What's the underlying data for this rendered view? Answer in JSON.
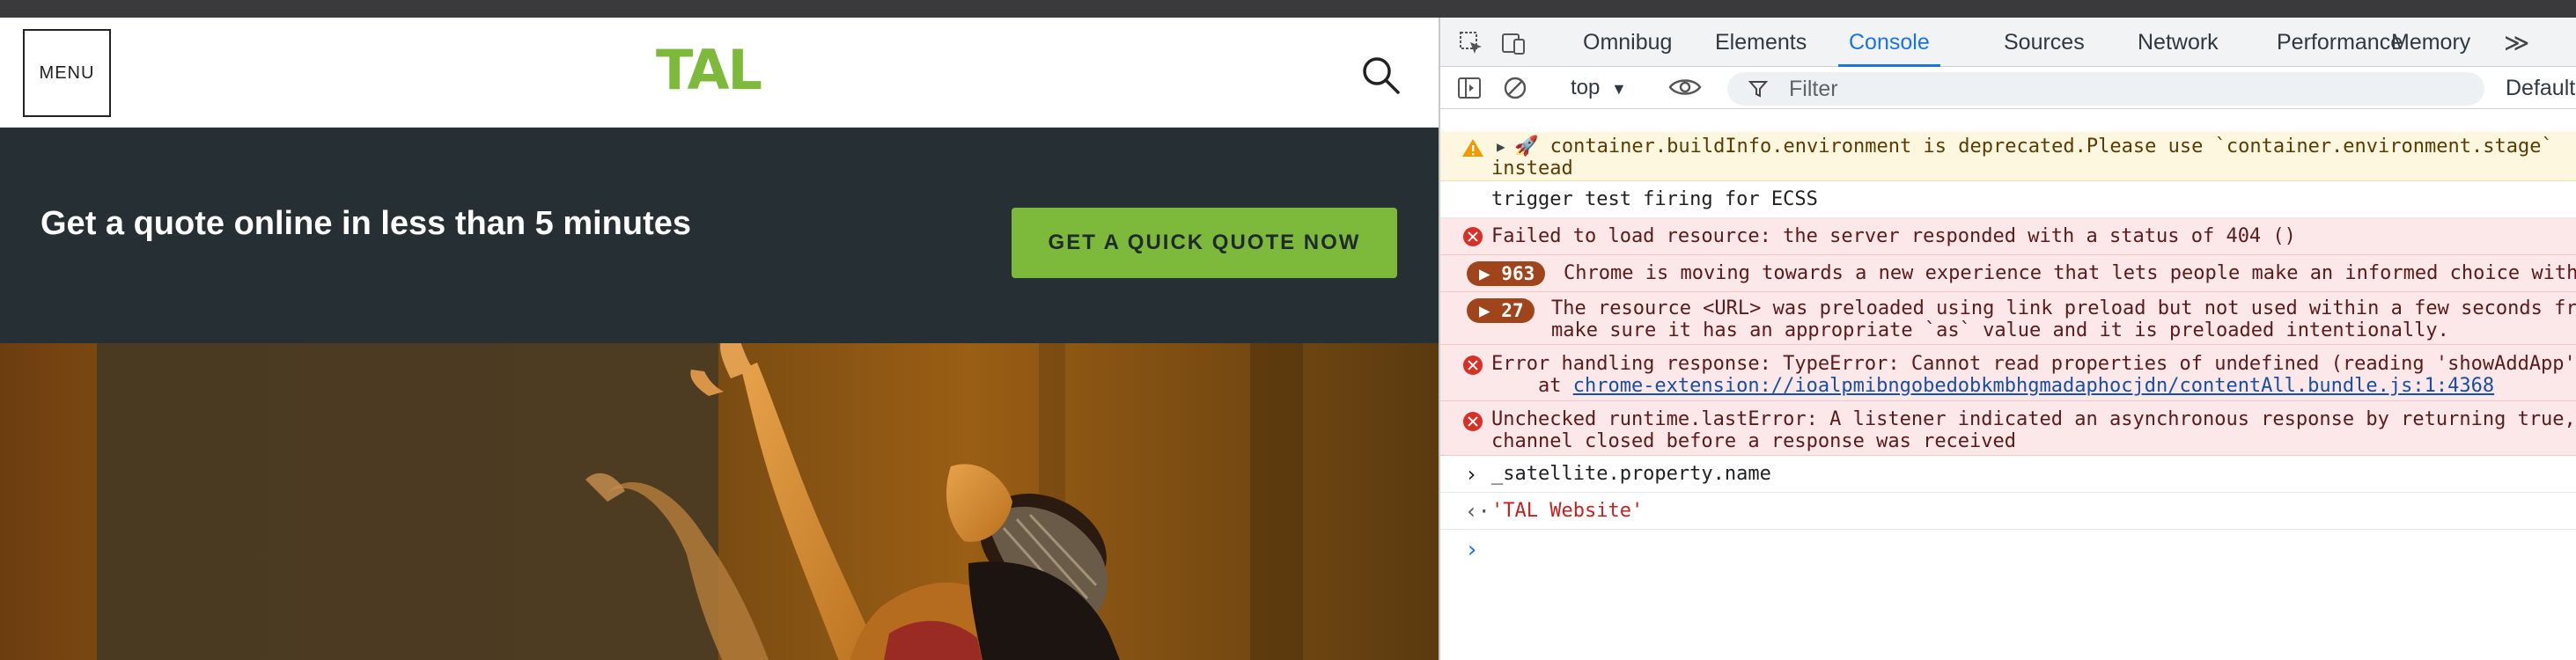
{
  "site": {
    "menu_label": "MENU",
    "logo_text": "TAL",
    "brand_color": "#7dba3c",
    "banner_title": "Get a quote online in less than 5 minutes",
    "cta_label": "GET A QUICK QUOTE NOW"
  },
  "devtools": {
    "tabs": [
      "Omnibug",
      "Elements",
      "Console",
      "Sources",
      "Network",
      "Performance",
      "Memory"
    ],
    "active_tab": "Console",
    "more_tabs_symbol": "≫",
    "toolbar": {
      "context": "top",
      "filter_placeholder": "Filter",
      "levels": "Default"
    },
    "console": {
      "warning": {
        "line1": "🚀 container.buildInfo.environment is deprecated.Please use `container.environment.stage`",
        "line2": "instead"
      },
      "info1": "trigger test firing for ECSS",
      "error1": "Failed to load resource: the server responded with a status of 404 ()",
      "grouped1": {
        "count": "963",
        "text": "Chrome is moving towards a new experience that lets people make an informed choice with"
      },
      "grouped2": {
        "count": "27",
        "line1": "The resource <URL> was preloaded using link preload but not used within a few seconds fr",
        "line2": "make sure it has an appropriate `as` value and it is preloaded intentionally."
      },
      "error2": {
        "line1": "Error handling response: TypeError: Cannot read properties of undefined (reading 'showAddApp'",
        "at": "    at ",
        "link": "chrome-extension://ioalpmibngobedobkmbhgmadaphocjdn/contentAll.bundle.js:1:4368"
      },
      "error3": {
        "line1": "Unchecked runtime.lastError: A listener indicated an asynchronous response by returning true,",
        "line2": "channel closed before a response was received"
      },
      "command": "_satellite.property.name",
      "result": "'TAL Website'"
    }
  }
}
